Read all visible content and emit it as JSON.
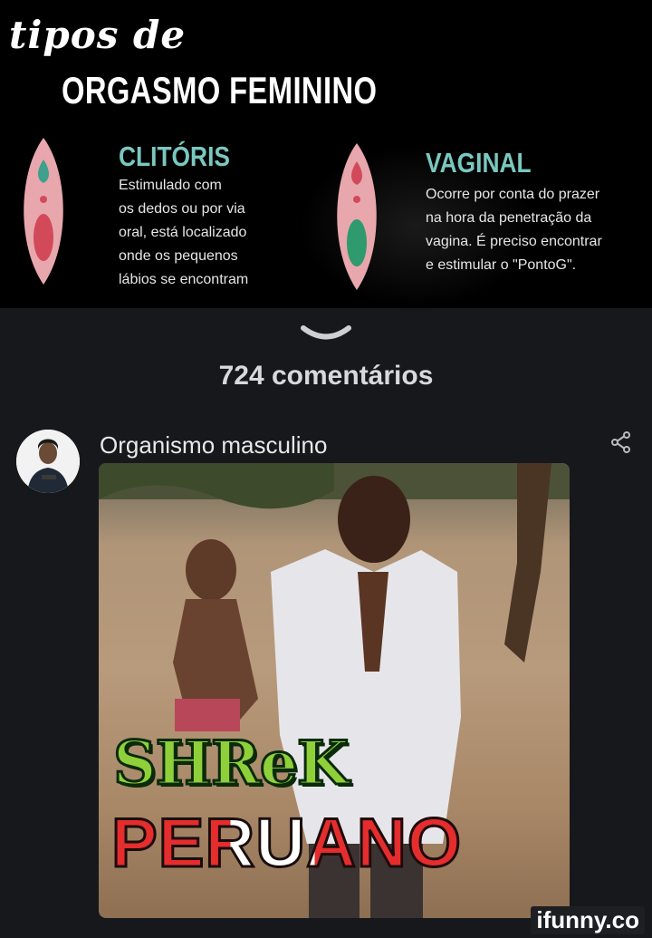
{
  "post": {
    "title_script": "tipos de",
    "title_main": "ORGASMO FEMININO",
    "left_section": {
      "title": "CLITÓRIS",
      "text": "Estimulado com\nos dedos ou por via\noral, está localizado\nonde os pequenos\nlábios se encontram"
    },
    "right_section": {
      "title": "VAGINAL",
      "text": "Ocorre por conta do prazer\nna hora da penetração da\nvagina. É preciso encontrar\ne estimular o \"PontoG\"."
    }
  },
  "comments": {
    "count_label": "724 comentários"
  },
  "comment": {
    "text": "Organismo masculino",
    "image_caption_line1": "SHReK",
    "image_caption_line2": "PERUANO"
  },
  "watermark": "ifunny.co",
  "icons": {
    "expand": "chevron-down-icon",
    "share": "share-icon"
  },
  "colors": {
    "background": "#17181c",
    "accent_teal": "#7ac8c0",
    "shape_pink": "#e8a7ad",
    "text_primary": "#e8e8ea"
  }
}
